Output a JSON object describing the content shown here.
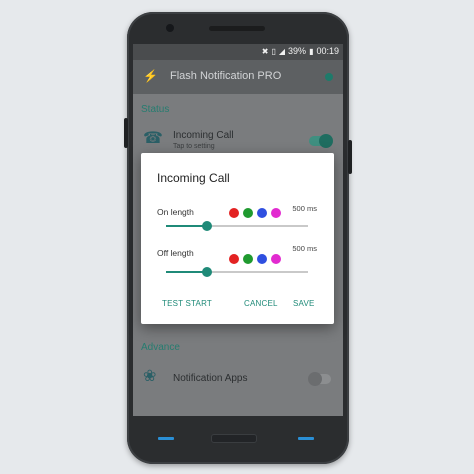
{
  "statusbar": {
    "battery": "39%",
    "time": "00:19",
    "icons": [
      "mute-icon",
      "vibrate-icon",
      "signal-icon",
      "battery-icon"
    ]
  },
  "toolbar": {
    "title": "Flash Notification PRO",
    "icon": "flash-icon",
    "master_switch_on": true
  },
  "background": {
    "section_status": "Status",
    "incoming_call": {
      "title": "Incoming Call",
      "subtitle": "Tap to setting",
      "icon": "phone-icon",
      "enabled": true
    },
    "section_advance": "Advance",
    "notification_apps": {
      "title": "Notification Apps",
      "icon": "fan-icon",
      "enabled": false
    }
  },
  "dialog": {
    "title": "Incoming Call",
    "on_length": {
      "label": "On length",
      "value": "500 ms",
      "fraction": 0.29
    },
    "off_length": {
      "label": "Off length",
      "value": "500 ms",
      "fraction": 0.29
    },
    "colors": [
      "#e32222",
      "#1f9a2f",
      "#2f4fe0",
      "#e22ad0"
    ],
    "buttons": {
      "test": "TEST START",
      "cancel": "CANCEL",
      "save": "SAVE"
    }
  },
  "colors": {
    "accent": "#1f8a78",
    "dim_overlay": "#7a7c7e",
    "nav_keys": "#2a8fd6"
  }
}
